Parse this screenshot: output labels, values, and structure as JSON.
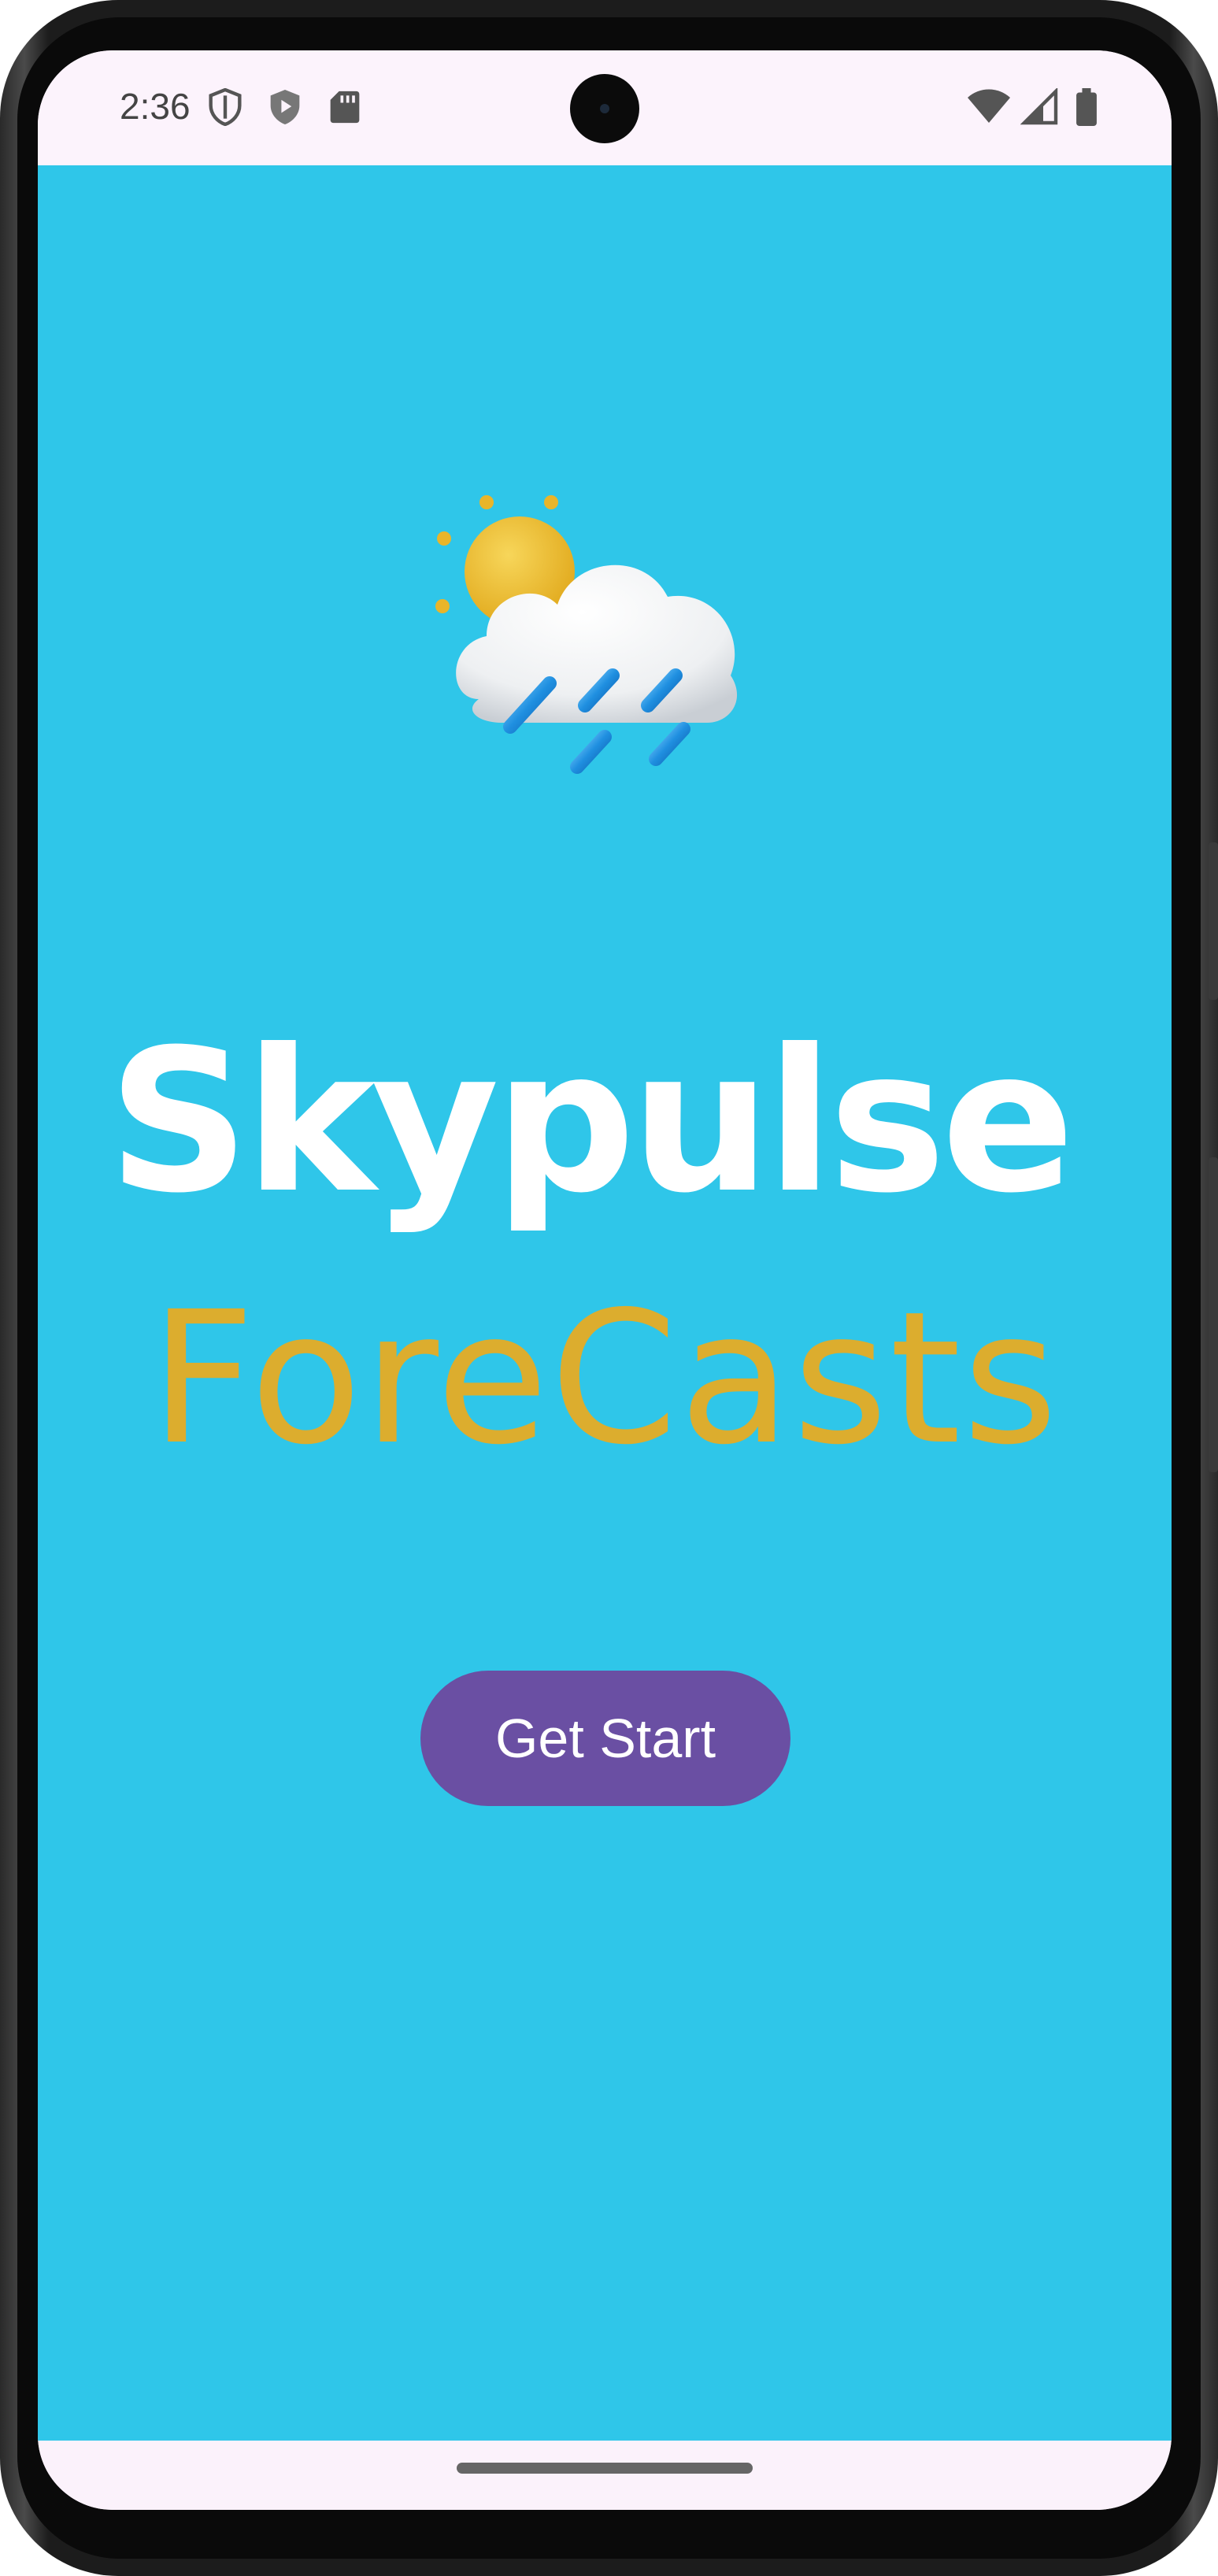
{
  "status_bar": {
    "time": "2:36",
    "left_icons": [
      "vpn-shield-icon",
      "play-protect-icon",
      "sd-card-icon"
    ],
    "right_icons": [
      "wifi-icon",
      "cellular-signal-icon",
      "battery-icon"
    ]
  },
  "app": {
    "background_color": "#2fc6e9",
    "logo_icon": "sun-cloud-rain-icon",
    "title_line1": "Skypulse",
    "title_line2": "ForeCasts",
    "title_line1_color": "#ffffff",
    "title_line2_color": "#dcad2e",
    "cta_label": "Get Start",
    "cta_color": "#6a4fa3"
  },
  "nav_bar": {
    "handle_icon": "gesture-handle"
  }
}
